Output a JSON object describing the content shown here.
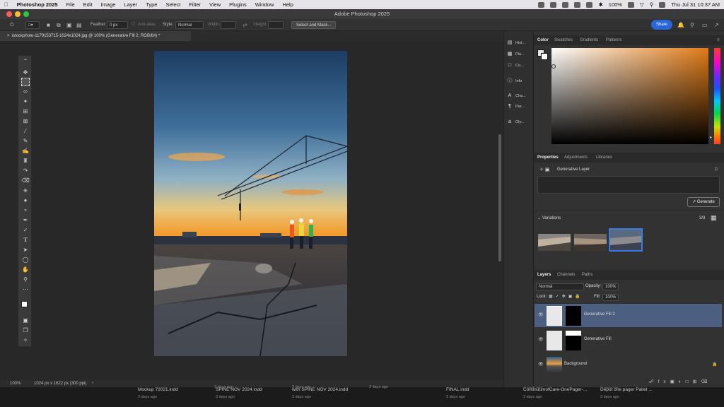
{
  "menubar": {
    "app_name": "Photoshop 2025",
    "items": [
      "File",
      "Edit",
      "Image",
      "Layer",
      "Type",
      "Select",
      "Filter",
      "View",
      "Plugins",
      "Window",
      "Help"
    ],
    "battery": "100%",
    "datetime": "Thu Jul 31  10:37 AM"
  },
  "window": {
    "title": "Adobe Photoshop 2025"
  },
  "options": {
    "feather_label": "Feather:",
    "feather_value": "0 px",
    "antialias_label": "Anti-alias",
    "style_label": "Style:",
    "style_value": "Normal",
    "width_label": "Width:",
    "height_label": "Height:",
    "select_mask_label": "Select and Mask...",
    "share_label": "Share"
  },
  "document": {
    "tab_title": "istockphoto-1179153715-1024x1024.jpg @ 100% (Generative Fill 2, RGB/8#) *"
  },
  "status": {
    "zoom": "100%",
    "dimensions": "1024 px x 1622 px (300 ppi)"
  },
  "collapsed_panels": [
    "Hist...",
    "Pla...",
    "Co...",
    "Info",
    "Cha...",
    "Par...",
    "Gly..."
  ],
  "color_panel": {
    "tabs": [
      "Color",
      "Swatches",
      "Gradients",
      "Patterns"
    ]
  },
  "properties_panel": {
    "tabs": [
      "Properties",
      "Adjustments",
      "Libraries"
    ],
    "layer_type": "Generative Layer",
    "generate_label": "Generate",
    "variations_label": "Variations",
    "variations_count": "3/3"
  },
  "layers_panel": {
    "tabs": [
      "Layers",
      "Channels",
      "Paths"
    ],
    "blend_mode": "Normal",
    "opacity_label": "Opacity:",
    "opacity_value": "100%",
    "lock_label": "Lock:",
    "fill_label": "Fill:",
    "fill_value": "100%",
    "layers": [
      {
        "name": "Generative Fill 2",
        "selected": true
      },
      {
        "name": "Generative Fill",
        "selected": false
      },
      {
        "name": "Background",
        "selected": false
      }
    ]
  },
  "finder_strip": [
    {
      "name": "Mockup 72021.indd",
      "date": "3 days ago"
    },
    {
      "name": "SPINE NOV 2024.indd",
      "date": "3 days ago"
    },
    {
      "name": "with SPINE NOV 2024.indd",
      "date": "3 days ago"
    },
    {
      "name": "FINAL.indd",
      "date": "3 days ago"
    },
    {
      "name": "ContinuumofCare-OnePager-...",
      "date": "3 days ago"
    },
    {
      "name": "Depot one pager Pallet ...",
      "date": "3 days ago"
    }
  ],
  "extra_dates": [
    "3 days ago",
    "3 days ago",
    "3 days ago",
    "3 days ago",
    "3 days ago"
  ],
  "colors": {
    "accent": "#2a68d8",
    "selection": "#4c5f80",
    "panel": "#323232"
  }
}
